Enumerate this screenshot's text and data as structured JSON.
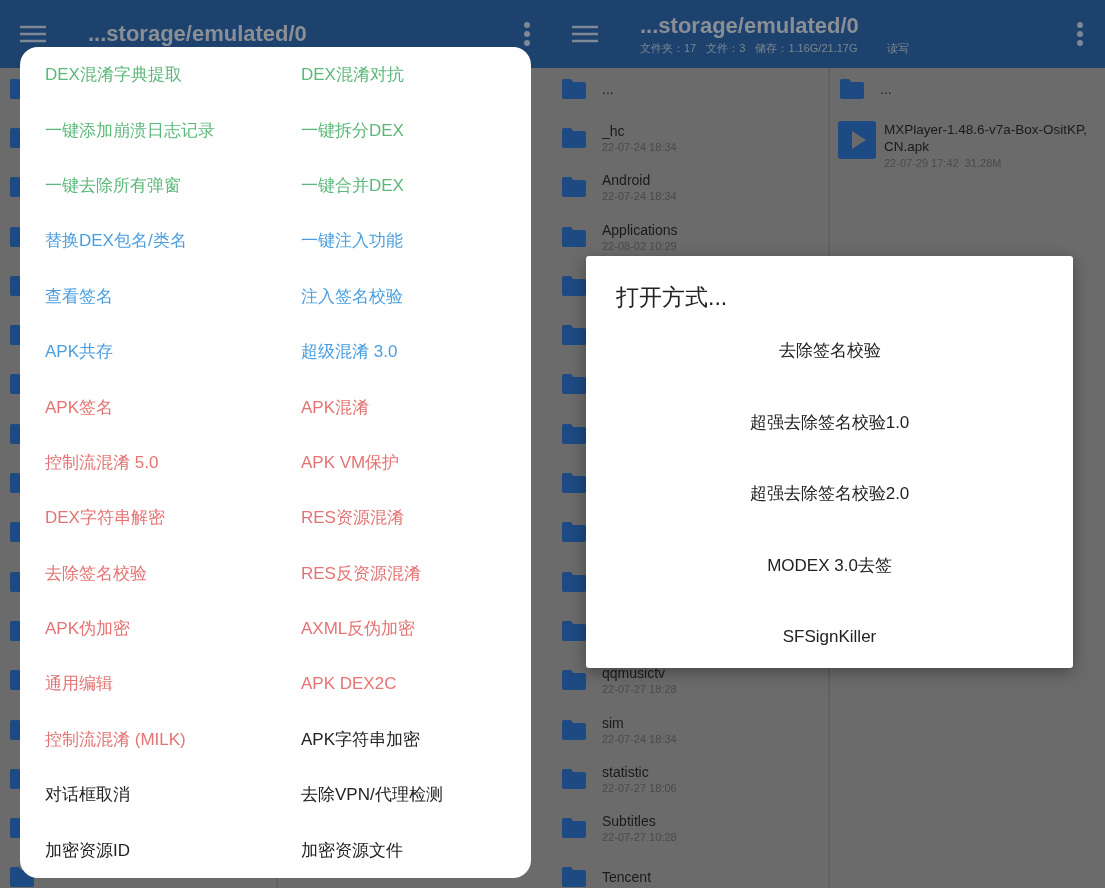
{
  "left_screen": {
    "app_bar": {
      "title": "...storage/emulated/0"
    },
    "list": [
      {
        "kind": "folder"
      },
      {
        "kind": "folder"
      },
      {
        "kind": "folder"
      },
      {
        "kind": "folder"
      },
      {
        "kind": "folder"
      },
      {
        "kind": "folder"
      },
      {
        "kind": "folder"
      },
      {
        "kind": "folder"
      },
      {
        "kind": "folder"
      },
      {
        "kind": "folder"
      },
      {
        "kind": "folder"
      },
      {
        "kind": "folder"
      },
      {
        "kind": "folder"
      },
      {
        "kind": "folder"
      },
      {
        "kind": "folder"
      },
      {
        "kind": "folder"
      },
      {
        "kind": "folder"
      }
    ],
    "menu": [
      {
        "label": "DEX混淆字典提取",
        "color": "#5cb87a"
      },
      {
        "label": "DEX混淆对抗",
        "color": "#5cb87a"
      },
      {
        "label": "一键添加崩溃日志记录",
        "color": "#5cb87a"
      },
      {
        "label": "一键拆分DEX",
        "color": "#5cb87a"
      },
      {
        "label": "一键去除所有弹窗",
        "color": "#5cb87a"
      },
      {
        "label": "一键合并DEX",
        "color": "#5cb87a"
      },
      {
        "label": "替换DEX包名/类名",
        "color": "#4a9ee0"
      },
      {
        "label": "一键注入功能",
        "color": "#4a9ee0"
      },
      {
        "label": "查看签名",
        "color": "#4a9ee0"
      },
      {
        "label": "注入签名校验",
        "color": "#4a9ee0"
      },
      {
        "label": "APK共存",
        "color": "#4a9ee0"
      },
      {
        "label": "超级混淆 3.0",
        "color": "#4a9ee0"
      },
      {
        "label": "APK签名",
        "color": "#e57373"
      },
      {
        "label": "APK混淆",
        "color": "#e57373"
      },
      {
        "label": "控制流混淆 5.0",
        "color": "#e57373"
      },
      {
        "label": "APK VM保护",
        "color": "#e57373"
      },
      {
        "label": "DEX字符串解密",
        "color": "#e57373"
      },
      {
        "label": "RES资源混淆",
        "color": "#e57373"
      },
      {
        "label": "去除签名校验",
        "color": "#e57373"
      },
      {
        "label": "RES反资源混淆",
        "color": "#e57373"
      },
      {
        "label": "APK伪加密",
        "color": "#e57373"
      },
      {
        "label": "AXML反伪加密",
        "color": "#e57373"
      },
      {
        "label": "通用编辑",
        "color": "#e57373"
      },
      {
        "label": "APK DEX2C",
        "color": "#e57373"
      },
      {
        "label": "控制流混淆 (MILK)",
        "color": "#e57373"
      },
      {
        "label": "APK字符串加密",
        "color": "#222222"
      },
      {
        "label": "对话框取消",
        "color": "#222222"
      },
      {
        "label": "去除VPN/代理检测",
        "color": "#222222"
      },
      {
        "label": "加密资源ID",
        "color": "#222222"
      },
      {
        "label": "加密资源文件",
        "color": "#222222"
      }
    ]
  },
  "right_screen": {
    "app_bar": {
      "title": "...storage/emulated/0",
      "subtitle": [
        "文件夹：17",
        "文件：3",
        "储存：1.16G/21.17G",
        "读写"
      ]
    },
    "list": [
      {
        "kind": "folder",
        "name": "..."
      },
      {
        "kind": "folder",
        "name": "_hc",
        "date": "22-07-24 18:34"
      },
      {
        "kind": "folder",
        "name": "Android",
        "date": "22-07-24 18:34"
      },
      {
        "kind": "folder",
        "name": "Applications",
        "date": "22-08-02 10:29"
      },
      {
        "kind": "folder"
      },
      {
        "kind": "folder"
      },
      {
        "kind": "folder"
      },
      {
        "kind": "folder"
      },
      {
        "kind": "folder"
      },
      {
        "kind": "folder"
      },
      {
        "kind": "folder"
      },
      {
        "kind": "folder"
      },
      {
        "kind": "folder",
        "name": "qqmusictv",
        "date": "22-07-27 18:28"
      },
      {
        "kind": "folder",
        "name": "sim",
        "date": "22-07-24 18:34"
      },
      {
        "kind": "folder",
        "name": "statistic",
        "date": "22-07-27 18:06"
      },
      {
        "kind": "folder",
        "name": "Subtitles",
        "date": "22-07-27 10:28"
      },
      {
        "kind": "folder",
        "name": "Tencent"
      }
    ],
    "side_list": [
      {
        "kind": "folder",
        "name": "..."
      },
      {
        "kind": "apk",
        "name": "MXPlayer-1.48.6-v7a-Box-OsitKP, CN.apk",
        "date": "22-07-29 17:42",
        "size": "31.28M"
      }
    ],
    "dialog": {
      "title": "打开方式...",
      "options": [
        "去除签名校验",
        "超强去除签名校验1.0",
        "超强去除签名校验2.0",
        "MODEX 3.0去签",
        "SFSignKiller"
      ]
    }
  }
}
